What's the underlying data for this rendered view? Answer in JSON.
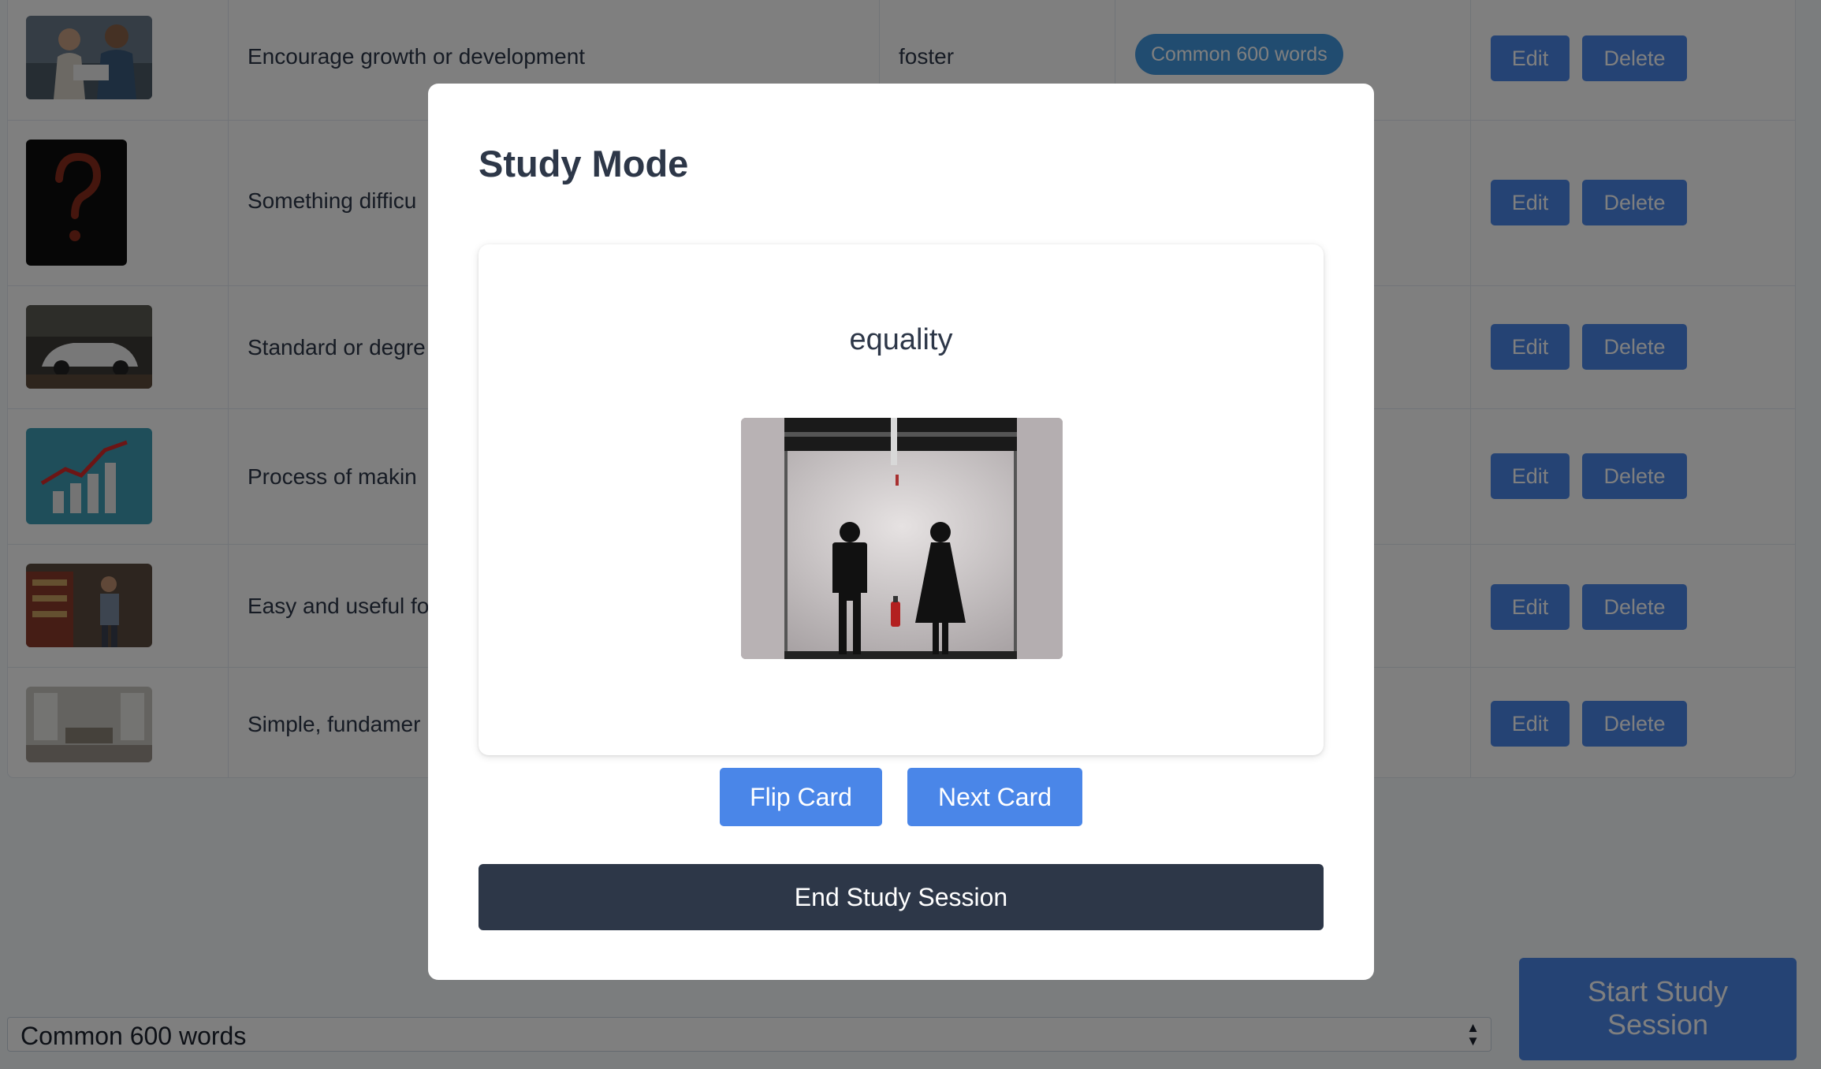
{
  "table": {
    "rows": [
      {
        "definition": "Encourage growth or development",
        "word": "foster",
        "tag": "Common 600 words",
        "edit_label": "Edit",
        "delete_label": "Delete",
        "thumb_icon": "reading-photo-icon"
      },
      {
        "definition": "Something difficu",
        "edit_label": "Edit",
        "delete_label": "Delete",
        "thumb_icon": "question-mark-photo-icon"
      },
      {
        "definition": "Standard or degre",
        "edit_label": "Edit",
        "delete_label": "Delete",
        "thumb_icon": "car-photo-icon"
      },
      {
        "definition": "Process of makin",
        "edit_label": "Edit",
        "delete_label": "Delete",
        "thumb_icon": "growth-chart-photo-icon"
      },
      {
        "definition": "Easy and useful fo",
        "edit_label": "Edit",
        "delete_label": "Delete",
        "thumb_icon": "shopping-photo-icon"
      },
      {
        "definition": "Simple, fundamer",
        "edit_label": "Edit",
        "delete_label": "Delete",
        "thumb_icon": "living-room-photo-icon"
      }
    ]
  },
  "footer": {
    "deck_select_value": "Common 600 words",
    "start_label_line1": "Start Study",
    "start_label_line2": "Session"
  },
  "modal": {
    "title": "Study Mode",
    "card_word": "equality",
    "card_image_icon": "restroom-signs-photo-icon",
    "flip_label": "Flip Card",
    "next_label": "Next Card",
    "end_label": "End Study Session"
  },
  "colors": {
    "primary": "#4a86e8",
    "tag": "#4299e1",
    "dark": "#2d3748",
    "overlay": "rgba(0,0,0,0.5)"
  }
}
